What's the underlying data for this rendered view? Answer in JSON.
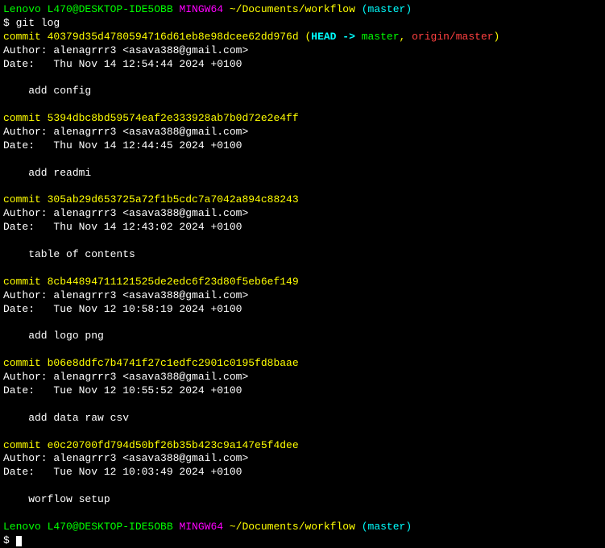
{
  "prompt1": {
    "user_host": "Lenovo L470@DESKTOP-IDE5OBB",
    "env": "MINGW64",
    "path": "~/Documents/workflow",
    "branch": "(master)"
  },
  "command": "$ git log",
  "commits": [
    {
      "hash_label": "commit 40379d35d4780594716d61eb8e98dcee62dd976d",
      "head_open": "(",
      "head_ref": "HEAD -> ",
      "branch": "master",
      "sep": ", ",
      "remote": "origin/master",
      "head_close": ")",
      "author": "Author: alenagrrr3 <asava388@gmail.com>",
      "date": "Date:   Thu Nov 14 12:54:44 2024 +0100",
      "message": "    add config",
      "has_head": true
    },
    {
      "hash_label": "commit 5394dbc8bd59574eaf2e333928ab7b0d72e2e4ff",
      "author": "Author: alenagrrr3 <asava388@gmail.com>",
      "date": "Date:   Thu Nov 14 12:44:45 2024 +0100",
      "message": "    add readmi",
      "has_head": false
    },
    {
      "hash_label": "commit 305ab29d653725a72f1b5cdc7a7042a894c88243",
      "author": "Author: alenagrrr3 <asava388@gmail.com>",
      "date": "Date:   Thu Nov 14 12:43:02 2024 +0100",
      "message": "    table of contents",
      "has_head": false
    },
    {
      "hash_label": "commit 8cb44894711121525de2edc6f23d80f5eb6ef149",
      "author": "Author: alenagrrr3 <asava388@gmail.com>",
      "date": "Date:   Tue Nov 12 10:58:19 2024 +0100",
      "message": "    add logo png",
      "has_head": false
    },
    {
      "hash_label": "commit b06e8ddfc7b4741f27c1edfc2901c0195fd8baae",
      "author": "Author: alenagrrr3 <asava388@gmail.com>",
      "date": "Date:   Tue Nov 12 10:55:52 2024 +0100",
      "message": "    add data raw csv",
      "has_head": false
    },
    {
      "hash_label": "commit e0c20700fd794d50bf26b35b423c9a147e5f4dee",
      "author": "Author: alenagrrr3 <asava388@gmail.com>",
      "date": "Date:   Tue Nov 12 10:03:49 2024 +0100",
      "message": "    worflow setup",
      "has_head": false
    }
  ],
  "prompt2": {
    "user_host": "Lenovo L470@DESKTOP-IDE5OBB",
    "env": "MINGW64",
    "path": "~/Documents/workflow",
    "branch": "(master)"
  },
  "prompt2_dollar": "$ "
}
